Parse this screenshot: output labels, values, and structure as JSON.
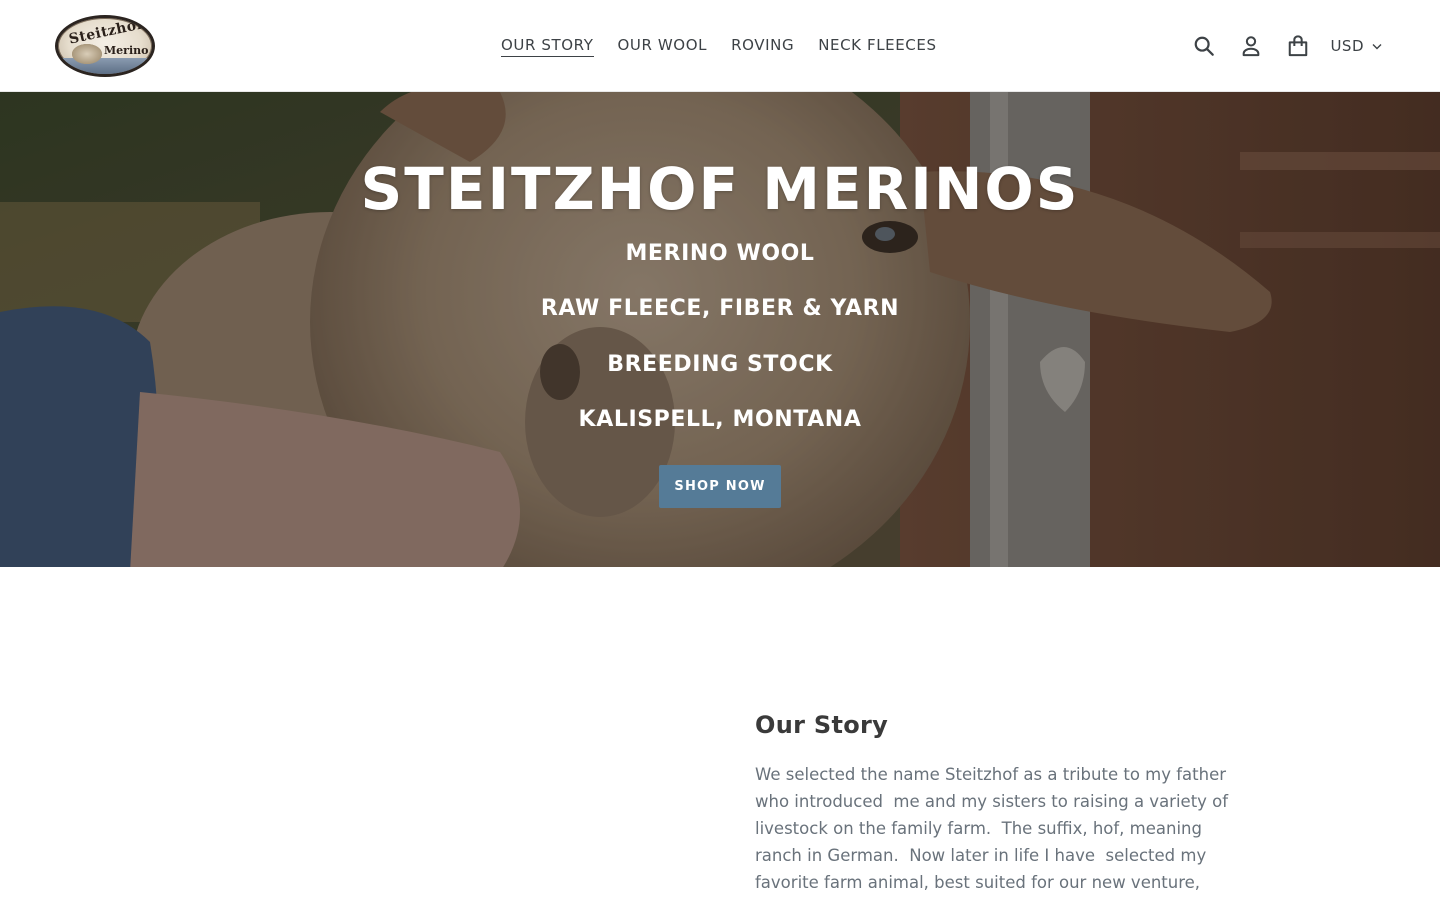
{
  "header": {
    "logo": {
      "line1": "Steitzhof",
      "line2": "Merino"
    },
    "nav": [
      {
        "label": "OUR STORY",
        "active": true
      },
      {
        "label": "OUR WOOL",
        "active": false
      },
      {
        "label": "ROVING",
        "active": false
      },
      {
        "label": "NECK FLEECES",
        "active": false
      }
    ],
    "icons": [
      "search-icon",
      "account-icon",
      "cart-icon"
    ],
    "currency": "USD"
  },
  "hero": {
    "title": "STEITZHOF MERINOS",
    "lines": [
      "MERINO WOOL",
      "RAW FLEECE, FIBER & YARN",
      "BREEDING STOCK",
      "KALISPELL, MONTANA"
    ],
    "button_label": "SHOP NOW"
  },
  "story": {
    "heading": "Our Story",
    "body_lines": [
      "We selected the name Steitzhof as a tribute to my father",
      "who introduced  me and my sisters to raising a variety of",
      "livestock on the family farm.  The suffix, hof, meaning",
      "ranch in German.  Now later in life I have  selected my",
      "favorite farm animal, best suited for our new venture,"
    ]
  },
  "colors": {
    "accent_button": "#557b97",
    "text_dark": "#3a3a3a",
    "text_body": "#69727b"
  }
}
